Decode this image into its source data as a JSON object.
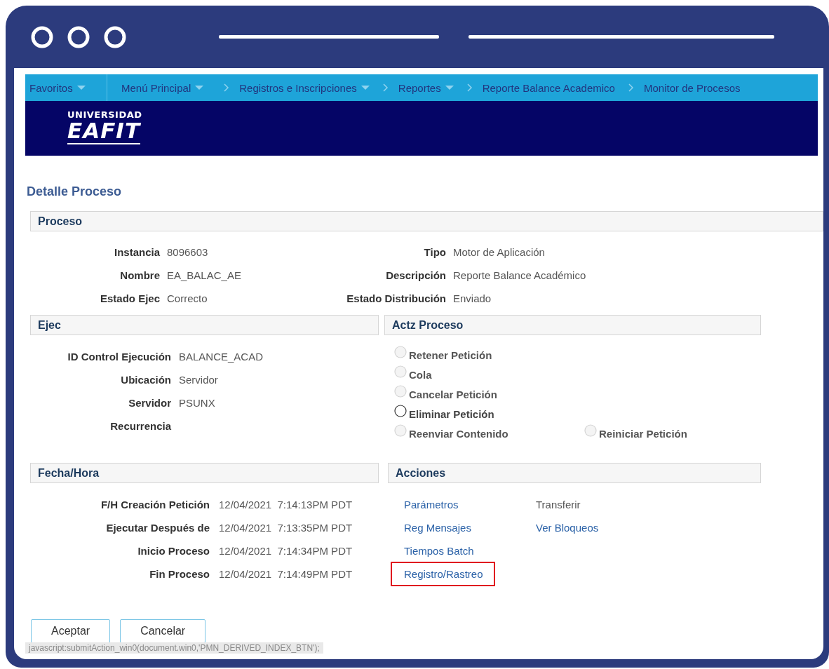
{
  "nav": {
    "items": [
      {
        "label": "Favoritos",
        "kind": "menu",
        "dropdown": true
      },
      {
        "label": "Menú Principal",
        "kind": "menu",
        "dropdown": true
      },
      {
        "label": "Registros e Inscripciones",
        "kind": "crumb",
        "dropdown": true
      },
      {
        "label": "Reportes",
        "kind": "crumb",
        "dropdown": true
      },
      {
        "label": "Reporte Balance Academico",
        "kind": "crumb",
        "dropdown": false
      },
      {
        "label": "Monitor de Procesos",
        "kind": "crumb",
        "dropdown": false
      }
    ]
  },
  "logo": {
    "line1": "UNIVERSIDAD",
    "line2": "EAFIT"
  },
  "page_title": "Detalle Proceso",
  "proceso": {
    "title": "Proceso",
    "rows": [
      {
        "left": {
          "label": "Instancia",
          "value": "8096603"
        },
        "right": {
          "label": "Tipo",
          "value": "Motor de Aplicación"
        }
      },
      {
        "left": {
          "label": "Nombre",
          "value": "EA_BALAC_AE"
        },
        "right": {
          "label": "Descripción",
          "value": "Reporte Balance Académico"
        }
      },
      {
        "left": {
          "label": "Estado Ejec",
          "value": "Correcto"
        },
        "right": {
          "label": "Estado Distribución",
          "value": "Enviado"
        }
      }
    ]
  },
  "ejec": {
    "title": "Ejec",
    "fields": [
      {
        "label": "ID Control Ejecución",
        "value": "BALANCE_ACAD"
      },
      {
        "label": "Ubicación",
        "value": "Servidor"
      },
      {
        "label": "Servidor",
        "value": "PSUNX"
      },
      {
        "label": "Recurrencia"
      }
    ]
  },
  "actz_proceso": {
    "title": "Actz Proceso",
    "rows": [
      [
        {
          "label": "Retener Petición",
          "selected": false,
          "disabled": true
        }
      ],
      [
        {
          "label": "Cola",
          "selected": false,
          "disabled": true
        }
      ],
      [
        {
          "label": "Cancelar Petición",
          "selected": false,
          "disabled": true
        }
      ],
      [
        {
          "label": "Eliminar Petición",
          "selected": false,
          "disabled": false
        }
      ],
      [
        {
          "label": "Reenviar Contenido",
          "selected": false,
          "disabled": true
        },
        {
          "label": "Reiniciar Petición",
          "selected": false,
          "disabled": true
        }
      ]
    ]
  },
  "fecha_hora": {
    "title": "Fecha/Hora",
    "fields": [
      {
        "label": "F/H Creación Petición",
        "date": "12/04/2021",
        "time": "7:14:13PM PDT"
      },
      {
        "label": "Ejecutar Después de",
        "date": "12/04/2021",
        "time": "7:13:35PM PDT"
      },
      {
        "label": "Inicio Proceso",
        "date": "12/04/2021",
        "time": "7:14:34PM PDT"
      },
      {
        "label": "Fin Proceso",
        "date": "12/04/2021",
        "time": "7:14:49PM PDT"
      }
    ]
  },
  "acciones": {
    "title": "Acciones",
    "columns": [
      [
        {
          "label": "Parámetros",
          "disabled": false,
          "highlighted": false
        },
        {
          "label": "Reg Mensajes",
          "disabled": false,
          "highlighted": false
        },
        {
          "label": "Tiempos Batch",
          "disabled": false,
          "highlighted": false
        },
        {
          "label": "Registro/Rastreo",
          "disabled": false,
          "highlighted": true
        }
      ],
      [
        {
          "label": "Transferir",
          "disabled": true,
          "highlighted": false
        },
        {
          "label": "Ver Bloqueos",
          "disabled": false,
          "highlighted": false
        }
      ]
    ]
  },
  "buttons": [
    {
      "label": "Aceptar"
    },
    {
      "label": "Cancelar"
    }
  ],
  "status_text": "javascript:submitAction_win0(document.win0,'PMN_DERIVED_INDEX_BTN');"
}
